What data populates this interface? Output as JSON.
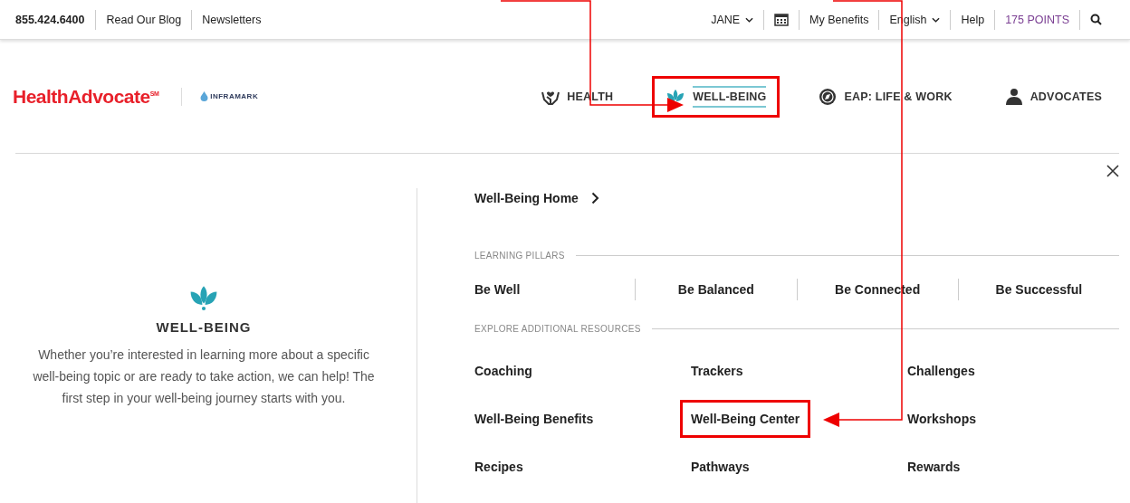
{
  "top_bar": {
    "phone": "855.424.6400",
    "links": [
      "Read Our Blog",
      "Newsletters"
    ],
    "user": "JANE",
    "benefits": "My Benefits",
    "language": "English",
    "help": "Help",
    "points": "175 POINTS"
  },
  "header": {
    "logo": "HealthAdvocate$^{SM}$",
    "partner": "INFRAMARK",
    "nav": [
      {
        "label": "HEALTH",
        "selected": false,
        "highlighted": false
      },
      {
        "label": "WELL-BEING",
        "selected": true,
        "highlighted": true
      },
      {
        "label": "EAP: LIFE & WORK",
        "selected": false,
        "highlighted": false
      },
      {
        "label": "ADVOCATES",
        "selected": false,
        "highlighted": false
      }
    ]
  },
  "mega_menu": {
    "intro": {
      "title": "WELL-BEING",
      "description": "Whether you’re interested in learning more about a specific well-being topic or are ready to take action, we can help! The first step in your well-being journey starts with you."
    },
    "home_link": "Well-Being Home",
    "sections": [
      {
        "title": "LEARNING PILLARS",
        "kind": "pillars",
        "items": [
          {
            "label": "Be Well",
            "highlighted": false
          },
          {
            "label": "Be Balanced",
            "highlighted": false
          },
          {
            "label": "Be Connected",
            "highlighted": false
          },
          {
            "label": "Be Successful",
            "highlighted": false
          }
        ]
      },
      {
        "title": "EXPLORE ADDITIONAL RESOURCES",
        "kind": "grid",
        "items": [
          {
            "label": "Coaching",
            "highlighted": false
          },
          {
            "label": "Trackers",
            "highlighted": false
          },
          {
            "label": "Challenges",
            "highlighted": false
          },
          {
            "label": "Well-Being Benefits",
            "highlighted": false
          },
          {
            "label": "Well-Being Center",
            "highlighted": true
          },
          {
            "label": "Workshops",
            "highlighted": false
          },
          {
            "label": "Recipes",
            "highlighted": false
          },
          {
            "label": "Pathways",
            "highlighted": false
          },
          {
            "label": "Rewards",
            "highlighted": false
          }
        ]
      }
    ]
  }
}
